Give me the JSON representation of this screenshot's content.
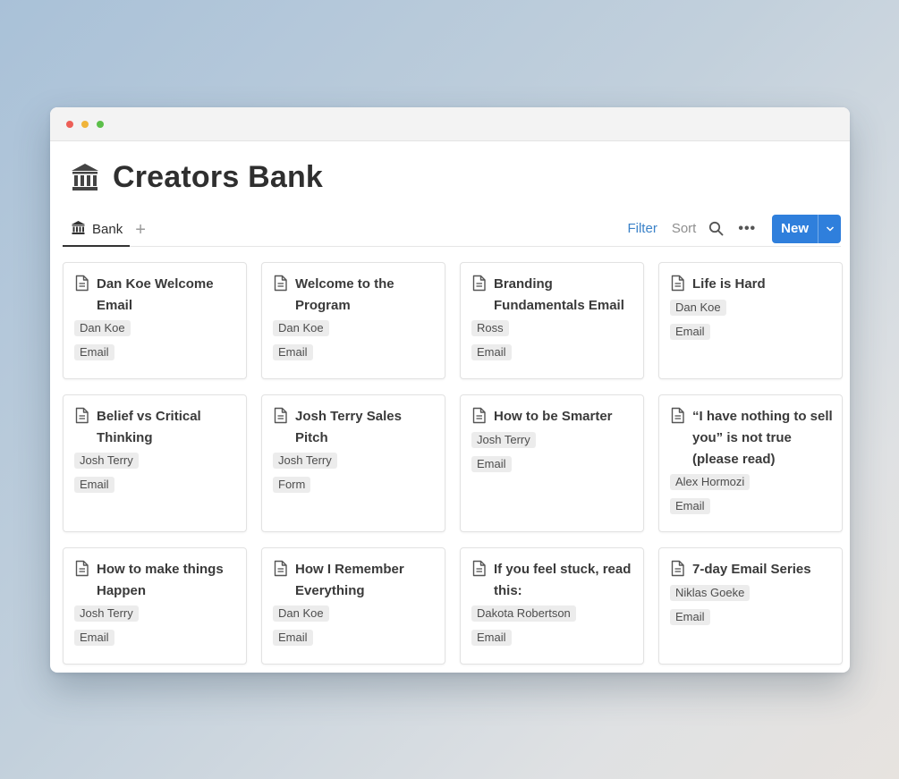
{
  "window": {
    "controls": [
      "close",
      "minimize",
      "zoom"
    ]
  },
  "page": {
    "icon": "bank-icon",
    "title": "Creators Bank"
  },
  "views": {
    "active_tab": {
      "icon": "bank-icon",
      "label": "Bank"
    },
    "add_view_label": "+"
  },
  "toolbar": {
    "filter_label": "Filter",
    "sort_label": "Sort",
    "search_icon": "search-icon",
    "more_label": "•••",
    "new_label": "New",
    "accent_color": "#2f7fdc"
  },
  "cards": [
    {
      "title": "Dan Koe Welcome Email",
      "tags": [
        "Dan Koe",
        "Email"
      ]
    },
    {
      "title": "Welcome to the Program",
      "tags": [
        "Dan Koe",
        "Email"
      ]
    },
    {
      "title": "Branding Fundamentals Email",
      "tags": [
        "Ross",
        "Email"
      ]
    },
    {
      "title": "Life is Hard",
      "tags": [
        "Dan Koe",
        "Email"
      ]
    },
    {
      "title": "Belief vs Critical Thinking",
      "tags": [
        "Josh Terry",
        "Email"
      ]
    },
    {
      "title": "Josh Terry Sales Pitch",
      "tags": [
        "Josh Terry",
        "Form"
      ]
    },
    {
      "title": "How to be Smarter",
      "tags": [
        "Josh Terry",
        "Email"
      ]
    },
    {
      "title": "“I have nothing to sell you” is not true (please read)",
      "tags": [
        "Alex Hormozi",
        "Email"
      ]
    },
    {
      "title": "How to make things Happen",
      "tags": [
        "Josh Terry",
        "Email"
      ]
    },
    {
      "title": "How I Remember Everything",
      "tags": [
        "Dan Koe",
        "Email"
      ]
    },
    {
      "title": "If you feel stuck, read this:",
      "tags": [
        "Dakota Robertson",
        "Email"
      ]
    },
    {
      "title": "7-day Email Series",
      "tags": [
        "Niklas Goeke",
        "Email"
      ]
    }
  ]
}
